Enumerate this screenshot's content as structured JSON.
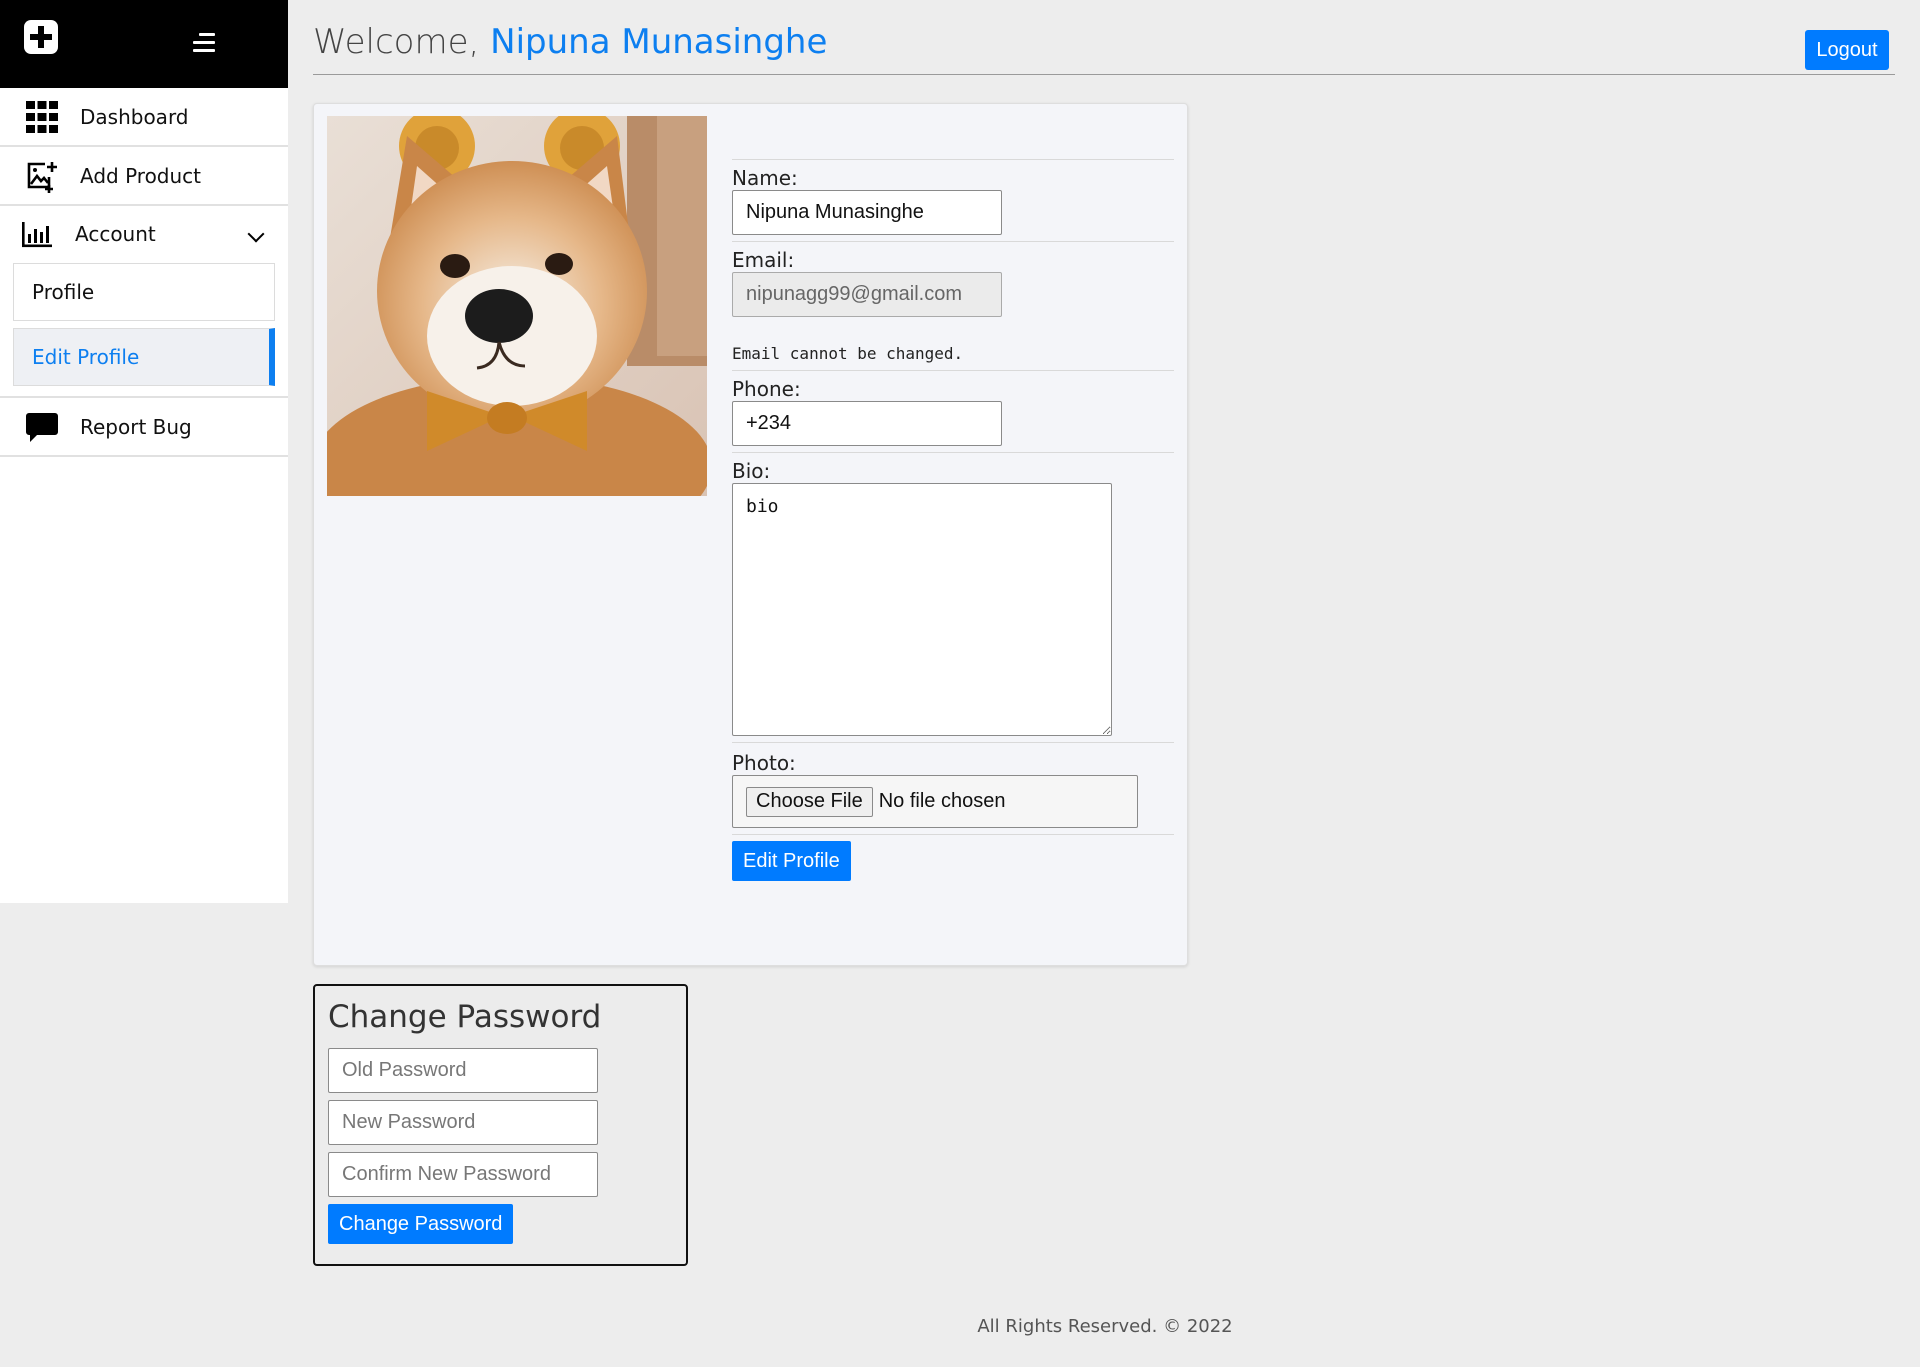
{
  "sidebar": {
    "items": [
      {
        "label": "Dashboard",
        "icon": "grid-icon"
      },
      {
        "label": "Add Product",
        "icon": "add-image-icon"
      },
      {
        "label": "Account",
        "icon": "bar-chart-icon"
      },
      {
        "label": "Report Bug",
        "icon": "chat-bubble-icon"
      }
    ],
    "submenu": [
      {
        "label": "Profile"
      },
      {
        "label": "Edit Profile",
        "active": true
      }
    ]
  },
  "header": {
    "welcome_prefix": "Welcome,",
    "user_name": "Nipuna Munasinghe",
    "logout_label": "Logout"
  },
  "profile_form": {
    "name_label": "Name:",
    "name_value": "Nipuna Munasinghe",
    "email_label": "Email:",
    "email_value": "nipunagg99@gmail.com",
    "email_hint": "Email cannot be changed.",
    "phone_label": "Phone:",
    "phone_value": "+234",
    "bio_label": "Bio:",
    "bio_value": "bio",
    "photo_label": "Photo:",
    "choose_file_label": "Choose File",
    "no_file_text": "No file chosen",
    "submit_label": "Edit Profile"
  },
  "change_password": {
    "title": "Change Password",
    "old_placeholder": "Old Password",
    "new_placeholder": "New Password",
    "confirm_placeholder": "Confirm New Password",
    "submit_label": "Change Password"
  },
  "footer": {
    "text": "All Rights Reserved. © 2022"
  },
  "colors": {
    "accent": "#007bff",
    "sidebar_top": "#000000",
    "page_bg": "#ededed"
  }
}
